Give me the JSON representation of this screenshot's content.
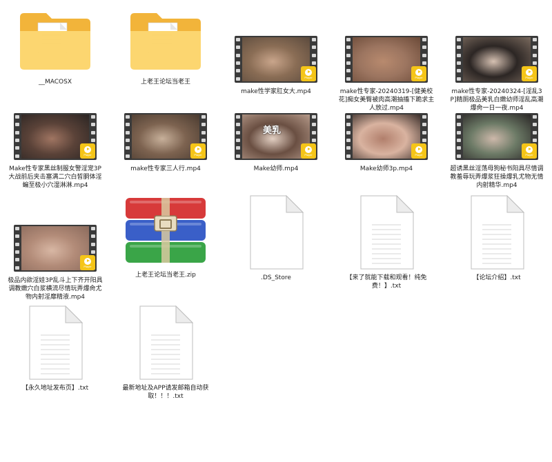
{
  "items": [
    {
      "type": "folder",
      "label": "__MACOSX",
      "has_paper": true
    },
    {
      "type": "folder",
      "label": "上老王论坛当老王",
      "has_paper": true
    },
    {
      "type": "video",
      "label": "make性学家肛女大.mp4",
      "colors": [
        "#5b4a3d",
        "#c9a58b",
        "#8a6d55"
      ]
    },
    {
      "type": "video",
      "label": "make性专家-20240319-[健美校花]痴女美臀被肉高潮抽搐下跪求主人放过.mp4",
      "colors": [
        "#6b4a38",
        "#b88a6e",
        "#9c7560"
      ]
    },
    {
      "type": "video",
      "label": "make性专家-20240324-[淫乱3P]精厕极品美乳白嫩幼师淫乱高潮爆肏一日一夜.mp4",
      "colors": [
        "#7a6a5e",
        "#d6c1b2",
        "#2c2624"
      ]
    },
    {
      "type": "video",
      "label": "Make性专家黑丝制服女警淫宠3P大战前后夹击塞满二穴白皙胴体淫蝙至极小穴湿淋淋.mp4",
      "colors": [
        "#2b2523",
        "#a07562",
        "#5a4238"
      ]
    },
    {
      "type": "video",
      "label": "make性专家三人行.mp4",
      "colors": [
        "#4a3b30",
        "#c7b09a",
        "#7d6350"
      ]
    },
    {
      "type": "video",
      "label": "Make幼师.mp4",
      "colors": [
        "#b59a8a",
        "#e2cfc2",
        "#6a4f42"
      ],
      "overlay": "美乳"
    },
    {
      "type": "video",
      "label": "Make幼师3p.mp4",
      "colors": [
        "#3a2e2a",
        "#b17f6c",
        "#d9b3a0"
      ]
    },
    {
      "type": "video",
      "label": "超诱黑丝淫荡母狗秘书阳具尽情调教羞辱玩弄爆浆狂操爆乳尤物无情内射精华.mp4",
      "colors": [
        "#2a2626",
        "#cdb8aa",
        "#6c7a66"
      ]
    },
    {
      "type": "video",
      "label": "极品内欲淫娃3P乱斗上下齐开阳具调教嫩穴白浆横流尽情玩弄爆肏尤物内射淫靡精液.mp4",
      "colors": [
        "#8a6a5c",
        "#d8b7a4",
        "#b28b78"
      ]
    },
    {
      "type": "zip",
      "label": "上老王论坛当老王.zip"
    },
    {
      "type": "doc",
      "label": ".DS_Store",
      "lines": false
    },
    {
      "type": "doc",
      "label": "【来了就能下载和观看！纯免费！】.txt",
      "lines": true
    },
    {
      "type": "doc",
      "label": "【论坛介绍】.txt",
      "lines": true
    },
    {
      "type": "doc",
      "label": "【永久地址发布页】.txt",
      "lines": true
    },
    {
      "type": "doc",
      "label": "最新地址及APP请发邮箱自动获取！！！.txt",
      "lines": true
    }
  ],
  "badge_text": "Player",
  "colors": {
    "folder_back": "#f2b43a",
    "folder_front": "#fcd46a",
    "badge": "#f5c518",
    "zip_red": "#d73a3a",
    "zip_blue": "#3a5fc8",
    "zip_green": "#3aa548"
  }
}
